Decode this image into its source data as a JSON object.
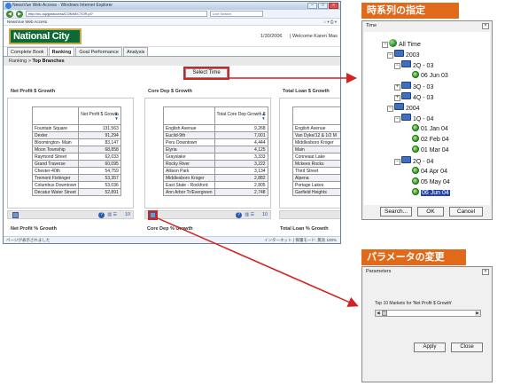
{
  "browser": {
    "title": "NewsVue Web Access - Windows Internet Explorer",
    "url": "http://nc-sql/jpeaccess/CONNECTOR.pl?",
    "search_placeholder": "Live Search",
    "fav_label": "NewsVue Web Access",
    "status_left": "ページが表示されました",
    "status_right": "インターネット | 保護モード: 無効     100%"
  },
  "app": {
    "logo": "National City",
    "date": "1/30/2006",
    "welcome": "|  Welcome  Karen Mas",
    "tabs": [
      "Complete Book",
      "Ranking",
      "Goal Performance",
      "Analysis"
    ],
    "active_tab": "Ranking",
    "breadcrumb_root": "Ranking",
    "breadcrumb_sep": ">",
    "breadcrumb_current": "Top Branches",
    "select_time_label": "Select Time"
  },
  "panels": [
    {
      "title": "Net Profit $ Growth",
      "column_header": "Net Profit $ Growth",
      "rows": [
        {
          "name": "Fountain Square",
          "value": "131,563"
        },
        {
          "name": "Dexter",
          "value": "91,294"
        },
        {
          "name": "Bloomington- Main",
          "value": "83,147"
        },
        {
          "name": "Moon Township",
          "value": "68,858"
        },
        {
          "name": "Raymond Street",
          "value": "62,033"
        },
        {
          "name": "Grand Traverse",
          "value": "60,095"
        },
        {
          "name": "Chester-40th",
          "value": "54,759"
        },
        {
          "name": "Tremont Fishinger",
          "value": "53,357"
        },
        {
          "name": "Columbus Downtown",
          "value": "53,036"
        },
        {
          "name": "Decatur Water Street",
          "value": "52,891"
        }
      ],
      "footer_count": "10"
    },
    {
      "title": "Core Dep $ Growth",
      "column_header": "Total Core Dep Growth $",
      "rows": [
        {
          "name": "English Avenue",
          "value": "9,268"
        },
        {
          "name": "Euclid-9th",
          "value": "7,001"
        },
        {
          "name": "Peru Downtown",
          "value": "4,444"
        },
        {
          "name": "Elyria",
          "value": "4,125"
        },
        {
          "name": "Grayslake",
          "value": "3,333"
        },
        {
          "name": "Rocky River",
          "value": "3,222"
        },
        {
          "name": "Allison Park",
          "value": "3,134"
        },
        {
          "name": "Middlesboro Kroger",
          "value": "2,882"
        },
        {
          "name": "East State - Rockford",
          "value": "2,805"
        },
        {
          "name": "Ann Arbor Tr/Evergreen",
          "value": "2,748"
        }
      ],
      "footer_count": "10"
    },
    {
      "title": "Total Loan $ Growth",
      "column_header": "",
      "rows": [
        {
          "name": "English Avenue",
          "value": ""
        },
        {
          "name": "Van Dyke/12 & 1/2 M",
          "value": ""
        },
        {
          "name": "Middlesboro Kroger",
          "value": ""
        },
        {
          "name": "Main",
          "value": ""
        },
        {
          "name": "Conneaut Lake",
          "value": ""
        },
        {
          "name": "Mckees Rocks",
          "value": ""
        },
        {
          "name": "Third Street",
          "value": ""
        },
        {
          "name": "Alpena",
          "value": ""
        },
        {
          "name": "Portage Lakes",
          "value": ""
        },
        {
          "name": "Garfield Heights",
          "value": ""
        }
      ],
      "footer_count": ""
    }
  ],
  "next_panel_titles": [
    "Net Profit % Growth",
    "Core Dep % Growth",
    "Total Loan % Growth"
  ],
  "callouts": {
    "time_spec": "時系列の指定",
    "param_change": "パラメータの変更"
  },
  "time_dialog": {
    "title": "Time",
    "tree": {
      "root": "All Time",
      "y2003": "2003",
      "q2_03": "2Q - 03",
      "jun06_03": "06 Jun 03",
      "q3_03": "3Q - 03",
      "q4_03": "4Q - 03",
      "y2004": "2004",
      "q1_04": "1Q - 04",
      "jan01_04": "01 Jan 04",
      "feb02_04": "02 Feb 04",
      "mar01_04": "01 Mar 04",
      "q2_04": "2Q - 04",
      "apr04_04": "04 Apr 04",
      "may05_04": "05 May 04",
      "jun06_04": "06 Jun 04"
    },
    "buttons": {
      "search": "Search...",
      "ok": "OK",
      "cancel": "Cancel"
    }
  },
  "params_dialog": {
    "title": "Parameters",
    "prompt": "Top 10 Markets for 'Net Profit $ Growth'",
    "buttons": {
      "apply": "Apply",
      "close": "Close"
    }
  },
  "colors": {
    "accent": "#e1691a",
    "highlight": "#d32222",
    "brand_green": "#0c6b35",
    "selection": "#2844a8"
  }
}
